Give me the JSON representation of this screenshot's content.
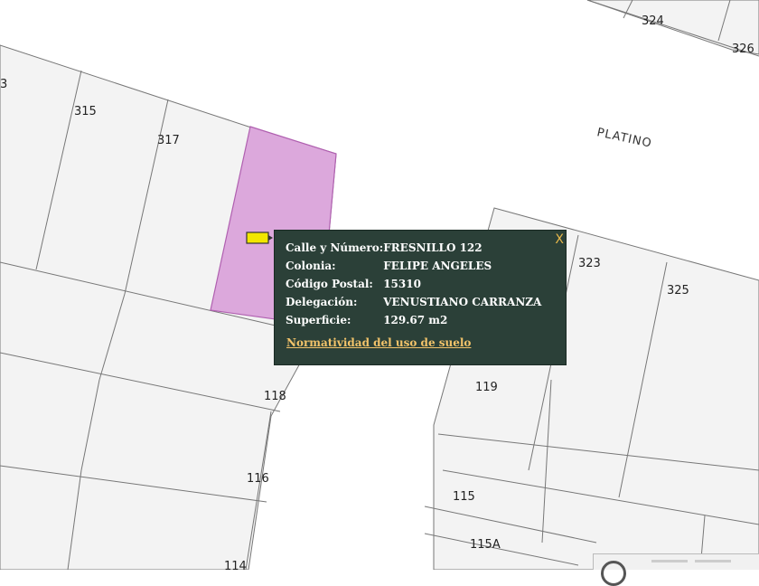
{
  "map": {
    "street_name": "PLATINO",
    "lot_labels": [
      "3",
      "315",
      "317",
      "324",
      "326",
      "323",
      "325",
      "118",
      "119",
      "116",
      "115",
      "115A",
      "114"
    ]
  },
  "popup": {
    "close_label": "X",
    "rows": [
      {
        "key": "Calle y Número:",
        "value": "FRESNILLO 122"
      },
      {
        "key": "Colonia:",
        "value": "FELIPE ANGELES"
      },
      {
        "key": "Código Postal:",
        "value": "15310"
      },
      {
        "key": "Delegación:",
        "value": "VENUSTIANO CARRANZA"
      },
      {
        "key": "Superficie:",
        "value": "129.67 m2"
      }
    ],
    "link_label": "Normatividad del uso de suelo"
  },
  "colors": {
    "selected_lot": "#dca8dc",
    "popup_bg": "#2b4038",
    "link": "#f2c36a",
    "marker": "#f2e600"
  }
}
